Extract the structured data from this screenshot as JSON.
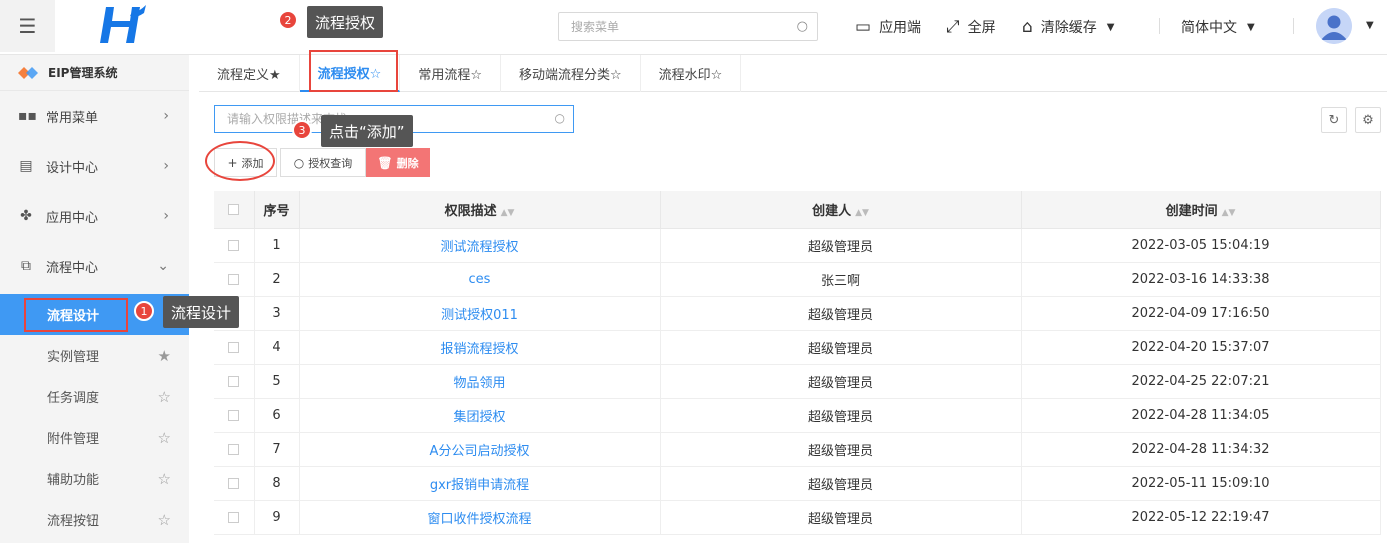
{
  "header": {
    "search_placeholder": "搜索菜单",
    "app_end": "应用端",
    "fullscreen": "全屏",
    "clear_cache": "清除缓存",
    "language": "简体中文"
  },
  "sidebar": {
    "brand": "EIP管理系统",
    "menus": [
      {
        "label": "常用菜单"
      },
      {
        "label": "设计中心"
      },
      {
        "label": "应用中心"
      },
      {
        "label": "流程中心"
      }
    ],
    "sub_items": [
      {
        "label": "流程设计"
      },
      {
        "label": "实例管理"
      },
      {
        "label": "任务调度"
      },
      {
        "label": "附件管理"
      },
      {
        "label": "辅助功能"
      },
      {
        "label": "流程按钮"
      }
    ]
  },
  "tabs": [
    {
      "label": "流程定义★"
    },
    {
      "label": "流程授权☆"
    },
    {
      "label": "常用流程☆"
    },
    {
      "label": "移动端流程分类☆"
    },
    {
      "label": "流程水印☆"
    }
  ],
  "toolbar": {
    "search_placeholder": "请输入权限描述来查找",
    "add": "添加",
    "query": "授权查询",
    "delete": "删除"
  },
  "table": {
    "headers": [
      "序号",
      "权限描述",
      "创建人",
      "创建时间"
    ],
    "rows": [
      {
        "no": "1",
        "desc": "测试流程授权",
        "creator": "超级管理员",
        "time": "2022-03-05 15:04:19"
      },
      {
        "no": "2",
        "desc": "ces",
        "creator": "张三啊",
        "time": "2022-03-16 14:33:38"
      },
      {
        "no": "3",
        "desc": "测试授权011",
        "creator": "超级管理员",
        "time": "2022-04-09 17:16:50"
      },
      {
        "no": "4",
        "desc": "报销流程授权",
        "creator": "超级管理员",
        "time": "2022-04-20 15:37:07"
      },
      {
        "no": "5",
        "desc": "物品领用",
        "creator": "超级管理员",
        "time": "2022-04-25 22:07:21"
      },
      {
        "no": "6",
        "desc": "集团授权",
        "creator": "超级管理员",
        "time": "2022-04-28 11:34:05"
      },
      {
        "no": "7",
        "desc": "A分公司启动授权",
        "creator": "超级管理员",
        "time": "2022-04-28 11:34:32"
      },
      {
        "no": "8",
        "desc": "gxr报销申请流程",
        "creator": "超级管理员",
        "time": "2022-05-11 15:09:10"
      },
      {
        "no": "9",
        "desc": "窗口收件授权流程",
        "creator": "超级管理员",
        "time": "2022-05-12 22:19:47"
      }
    ]
  },
  "annotations": [
    {
      "num": "1",
      "text": "流程设计"
    },
    {
      "num": "2",
      "text": "流程授权"
    },
    {
      "num": "3",
      "text": "点击“添加”"
    }
  ],
  "colors": {
    "accent": "#2d8cf0",
    "active_menu": "#3f99f3",
    "danger": "#f37575",
    "annotation": "#e8453c"
  }
}
